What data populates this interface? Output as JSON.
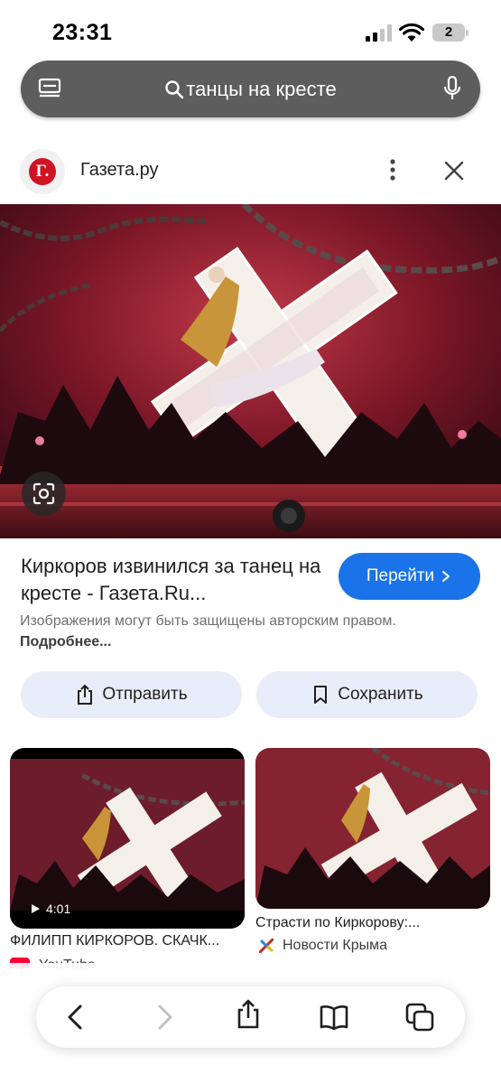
{
  "status_bar": {
    "time": "23:31",
    "battery": "2"
  },
  "search": {
    "query": "танцы на кресте"
  },
  "source": {
    "logo_text": "Г.",
    "name": "Газета.ру"
  },
  "result": {
    "title": "Киркоров извинился за танец на кресте - Газета.Ru...",
    "go_label": "Перейти",
    "copyright_text": "Изображения могут быть защищены авторским правом.",
    "copyright_more": "Подробнее..."
  },
  "actions": {
    "share_label": "Отправить",
    "save_label": "Сохранить"
  },
  "related": [
    {
      "title": "ФИЛИПП КИРКОРОВ. СКАЧК...",
      "source": "YouTube",
      "duration": "4:01"
    },
    {
      "title": "Страсти по Киркорову:...",
      "source": "Новости Крыма"
    }
  ],
  "colors": {
    "accent": "#1a73e8",
    "search_bar": "#5d5d5d",
    "action_bg": "#e8eef9",
    "brand_red": "#cf1322"
  },
  "icons": [
    "tabs-icon",
    "search-icon",
    "mic-icon",
    "more-icon",
    "close-icon",
    "lens-icon",
    "chevron-right-icon",
    "share-icon",
    "bookmark-icon",
    "play-icon",
    "back-icon",
    "forward-icon",
    "book-icon",
    "tabs-overview-icon"
  ]
}
